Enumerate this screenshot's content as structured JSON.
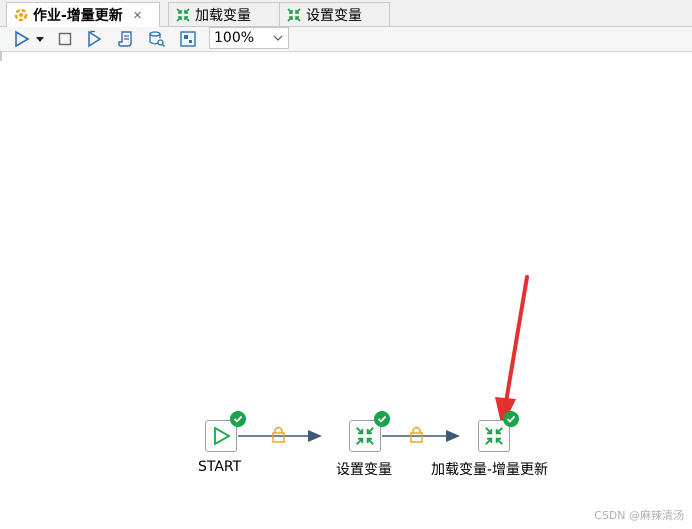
{
  "tabs": [
    {
      "label": "作业-增量更新",
      "active": true,
      "closable": true
    },
    {
      "label": "加载变量",
      "active": false
    },
    {
      "label": "设置变量",
      "active": false
    }
  ],
  "toolbar": {
    "zoom_value": "100%",
    "icons": [
      "run-icon",
      "dropdown-arrow-icon",
      "stop-icon",
      "preview-icon",
      "script-icon",
      "db-search-icon",
      "layout-icon"
    ]
  },
  "nodes": [
    {
      "label": "START",
      "status": "success"
    },
    {
      "label": "设置变量",
      "status": "success"
    },
    {
      "label": "加载变量-增量更新",
      "status": "success"
    }
  ],
  "watermark": "CSDN @麻辣清汤",
  "colors": {
    "accent_green": "#1aa34a",
    "hop_line": "#3c5a78",
    "lock": "#e8a317",
    "annotation_arrow": "#e53030"
  }
}
